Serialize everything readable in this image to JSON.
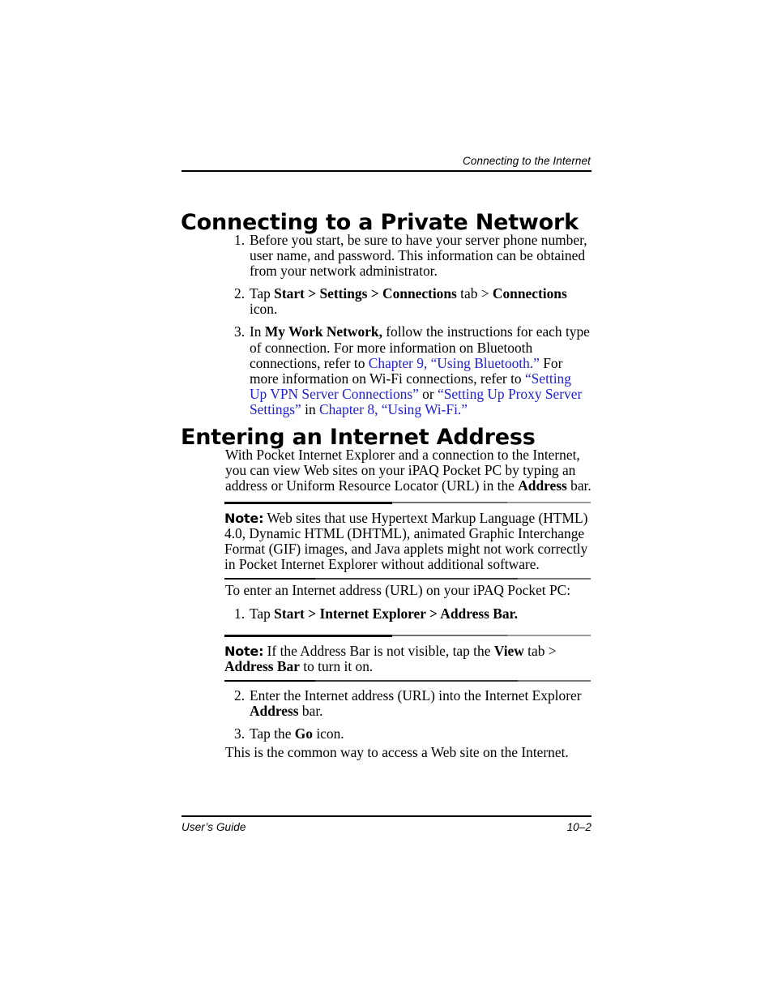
{
  "header": {
    "running_head": "Connecting to the Internet"
  },
  "sections": [
    {
      "heading": "Connecting to a Private Network",
      "steps": [
        {
          "number": "1.",
          "parts": [
            {
              "text": "Before you start, be sure to have your server phone number, user name, and password. This information can be obtained from your network administrator.",
              "style": "normal"
            }
          ]
        },
        {
          "number": "2.",
          "parts": [
            {
              "text": "Tap ",
              "style": "normal"
            },
            {
              "text": "Start",
              "style": "bold"
            },
            {
              "text": " > ",
              "style": "bold"
            },
            {
              "text": "Settings",
              "style": "bold"
            },
            {
              "text": " > ",
              "style": "bold"
            },
            {
              "text": "Connections",
              "style": "bold"
            },
            {
              "text": " tab > ",
              "style": "normal"
            },
            {
              "text": "Connections",
              "style": "bold"
            },
            {
              "text": " icon.",
              "style": "normal"
            }
          ]
        },
        {
          "number": "3.",
          "parts": [
            {
              "text": "In ",
              "style": "normal"
            },
            {
              "text": "My Work Network,",
              "style": "bold"
            },
            {
              "text": " follow the instructions for each type of connection. For more information on Bluetooth connections, refer to ",
              "style": "normal"
            },
            {
              "text": "Chapter 9, “Using Bluetooth.”",
              "style": "link"
            },
            {
              "text": " For more information on Wi-Fi connections, refer to ",
              "style": "normal"
            },
            {
              "text": "“Setting Up VPN Server Connections”",
              "style": "link"
            },
            {
              "text": " or ",
              "style": "normal"
            },
            {
              "text": "“Setting Up Proxy Server Settings”",
              "style": "link"
            },
            {
              "text": " in ",
              "style": "normal"
            },
            {
              "text": "Chapter 8, “Using Wi-Fi.”",
              "style": "link"
            }
          ]
        }
      ]
    },
    {
      "heading": "Entering an Internet Address",
      "intro": [
        {
          "text": "With Pocket Internet Explorer and a connection to the Internet, you can view Web sites on your iPAQ Pocket PC by typing an address or Uniform Resource Locator (URL) in the ",
          "style": "normal"
        },
        {
          "text": "Address",
          "style": "bold"
        },
        {
          "text": " bar.",
          "style": "normal"
        }
      ]
    }
  ],
  "note_one": {
    "label": "Note:",
    "parts": [
      {
        "text": " Web sites that use Hypertext Markup Language (HTML) 4.0, Dynamic HTML (DHTML), animated Graphic Interchange Format (GIF) images, and Java applets might not work correctly in Pocket Internet Explorer without additional software.",
        "style": "normal"
      }
    ]
  },
  "lead_in": {
    "text": "To enter an Internet address (URL) on your iPAQ Pocket PC:"
  },
  "step_one": {
    "number": "1.",
    "parts": [
      {
        "text": "Tap ",
        "style": "normal"
      },
      {
        "text": "Start > Internet Explorer > Address Bar.",
        "style": "bold"
      }
    ]
  },
  "note_two": {
    "label": "Note:",
    "parts": [
      {
        "text": " If the Address Bar is not visible, tap the ",
        "style": "normal"
      },
      {
        "text": "View",
        "style": "bold"
      },
      {
        "text": " tab > ",
        "style": "normal"
      },
      {
        "text": "Address Bar",
        "style": "bold"
      },
      {
        "text": " to turn it on.",
        "style": "normal"
      }
    ]
  },
  "final_steps": [
    {
      "number": "2.",
      "parts": [
        {
          "text": "Enter the Internet address (URL) into the Internet Explorer ",
          "style": "normal"
        },
        {
          "text": "Address",
          "style": "bold"
        },
        {
          "text": " bar.",
          "style": "normal"
        }
      ]
    },
    {
      "number": "3.",
      "parts": [
        {
          "text": "Tap the ",
          "style": "normal"
        },
        {
          "text": "Go",
          "style": "bold"
        },
        {
          "text": " icon.",
          "style": "normal"
        }
      ]
    }
  ],
  "closing": {
    "text": "This is the common way to access a Web site on the Internet."
  },
  "footer": {
    "left": "User’s Guide",
    "right": "10–2"
  },
  "colors": {
    "link": "#2020DC",
    "text": "#000000",
    "rule": "#000000"
  }
}
